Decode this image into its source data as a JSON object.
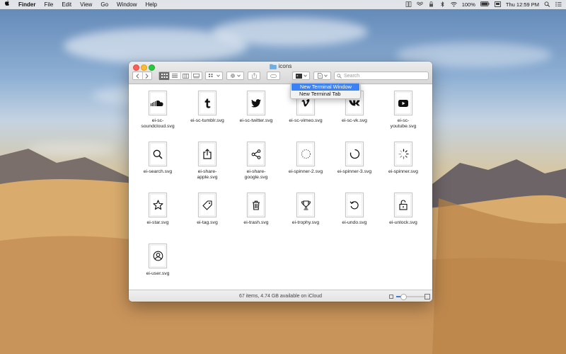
{
  "menubar": {
    "apple": "",
    "items": [
      "Finder",
      "File",
      "Edit",
      "View",
      "Go",
      "Window",
      "Help"
    ],
    "battery": "100%",
    "clock": "Thu 12:59 PM"
  },
  "window": {
    "title": "icons",
    "search_placeholder": "Search",
    "status": "67 items, 4.74 GB available on iCloud"
  },
  "dropdown": {
    "items": [
      "New Terminal Window",
      "New Terminal Tab"
    ]
  },
  "files": [
    {
      "name": "ei-sc-soundcloud.svg",
      "lines": [
        "ei-sc-",
        "soundcloud.svg"
      ],
      "icon": "soundcloud-icon"
    },
    {
      "name": "ei-sc-tumblr.svg",
      "lines": [
        "ei-sc-tumblr.svg"
      ],
      "icon": "tumblr-icon"
    },
    {
      "name": "ei-sc-twitter.svg",
      "lines": [
        "ei-sc-twitter.svg"
      ],
      "icon": "twitter-icon"
    },
    {
      "name": "ei-sc-vimeo.svg",
      "lines": [
        "ei-sc-vimeo.svg"
      ],
      "icon": "vimeo-icon"
    },
    {
      "name": "ei-sc-vk.svg",
      "lines": [
        "ei-sc-vk.svg"
      ],
      "icon": "vk-icon"
    },
    {
      "name": "ei-sc-youtube.svg",
      "lines": [
        "ei-sc-",
        "youtube.svg"
      ],
      "icon": "youtube-icon"
    },
    {
      "name": "ei-search.svg",
      "lines": [
        "ei-search.svg"
      ],
      "icon": "search-icon"
    },
    {
      "name": "ei-share-apple.svg",
      "lines": [
        "ei-share-",
        "apple.svg"
      ],
      "icon": "share-apple-icon"
    },
    {
      "name": "ei-share-google.svg",
      "lines": [
        "ei-share-",
        "google.svg"
      ],
      "icon": "share-google-icon"
    },
    {
      "name": "ei-spinner-2.svg",
      "lines": [
        "ei-spinner-2.svg"
      ],
      "icon": "spinner-dotted-icon"
    },
    {
      "name": "ei-spinner-3.svg",
      "lines": [
        "ei-spinner-3.svg"
      ],
      "icon": "spinner-arc-icon"
    },
    {
      "name": "ei-spinner.svg",
      "lines": [
        "ei-spinner.svg"
      ],
      "icon": "spinner-icon"
    },
    {
      "name": "ei-star.svg",
      "lines": [
        "ei-star.svg"
      ],
      "icon": "star-icon"
    },
    {
      "name": "ei-tag.svg",
      "lines": [
        "ei-tag.svg"
      ],
      "icon": "tag-icon"
    },
    {
      "name": "ei-trash.svg",
      "lines": [
        "ei-trash.svg"
      ],
      "icon": "trash-icon"
    },
    {
      "name": "ei-trophy.svg",
      "lines": [
        "ei-trophy.svg"
      ],
      "icon": "trophy-icon"
    },
    {
      "name": "ei-undo.svg",
      "lines": [
        "ei-undo.svg"
      ],
      "icon": "undo-icon"
    },
    {
      "name": "ei-unlock.svg",
      "lines": [
        "ei-unlock.svg"
      ],
      "icon": "unlock-icon"
    },
    {
      "name": "ei-user.svg",
      "lines": [
        "ei-user.svg"
      ],
      "icon": "user-icon"
    }
  ]
}
